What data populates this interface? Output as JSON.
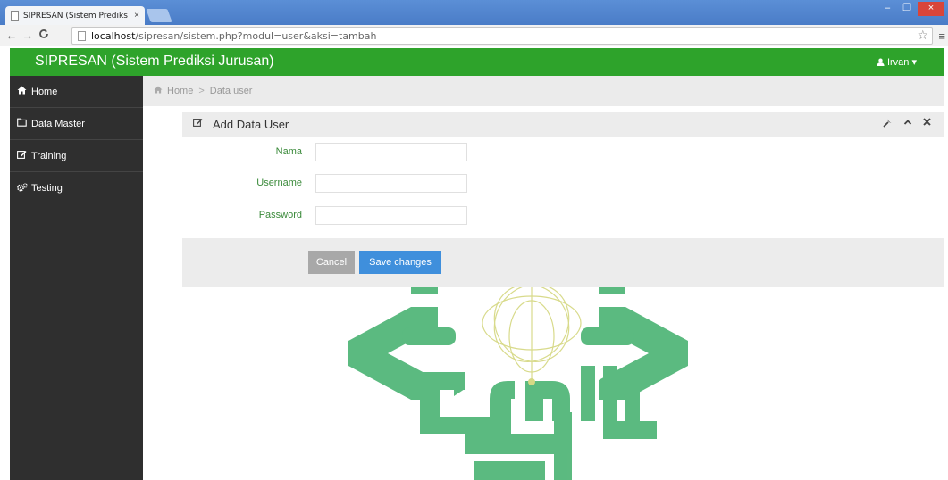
{
  "browser": {
    "tab_title": "SIPRESAN (Sistem Prediks",
    "tab_close": "×",
    "url_host": "localhost",
    "url_path": "/sipresan/sistem.php?modul=user&aksi=tambah",
    "window_min": "–",
    "window_max": "❐",
    "window_close": "×"
  },
  "app": {
    "brand": "SIPRESAN (Sistem Prediksi Jurusan)",
    "user_label": "Irvan",
    "user_caret": "▾",
    "user_icon": "user-icon",
    "accent_color": "#2ea32b"
  },
  "sidebar": {
    "items": [
      {
        "label": "Home",
        "icon": "home-icon"
      },
      {
        "label": "Data Master",
        "icon": "folder-icon"
      },
      {
        "label": "Training",
        "icon": "edit-icon"
      },
      {
        "label": "Testing",
        "icon": "gears-icon"
      }
    ]
  },
  "breadcrumb": {
    "home": "Home",
    "current": "Data user",
    "separator": ">"
  },
  "form": {
    "title": "Add Data User",
    "fields": [
      {
        "label": "Nama",
        "value": ""
      },
      {
        "label": "Username",
        "value": ""
      },
      {
        "label": "Password",
        "value": ""
      }
    ],
    "cancel_label": "Cancel",
    "save_label": "Save changes"
  }
}
